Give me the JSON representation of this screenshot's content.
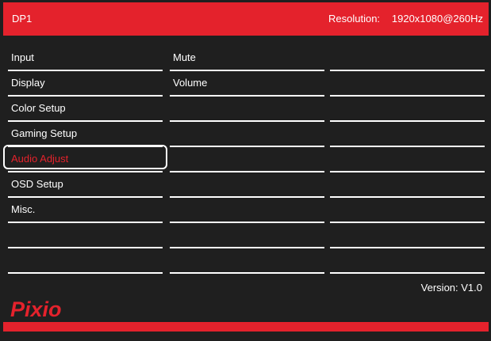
{
  "header": {
    "source": "DP1",
    "resolution_label": "Resolution:",
    "resolution_value": "1920x1080@260Hz"
  },
  "menu": {
    "main": [
      "Input",
      "Display",
      "Color Setup",
      "Gaming Setup",
      "Audio Adjust",
      "OSD Setup",
      "Misc.",
      "",
      ""
    ],
    "selected": "Audio Adjust",
    "submenu": [
      "Mute",
      "Volume",
      "",
      "",
      "",
      "",
      "",
      "",
      ""
    ],
    "values": [
      "",
      "",
      "",
      "",
      "",
      "",
      "",
      "",
      ""
    ]
  },
  "footer": {
    "version": "Version: V1.0",
    "logo": "Pixio"
  },
  "colors": {
    "accent": "#e4222c",
    "background": "#1f1f1f",
    "text": "#ffffff"
  }
}
